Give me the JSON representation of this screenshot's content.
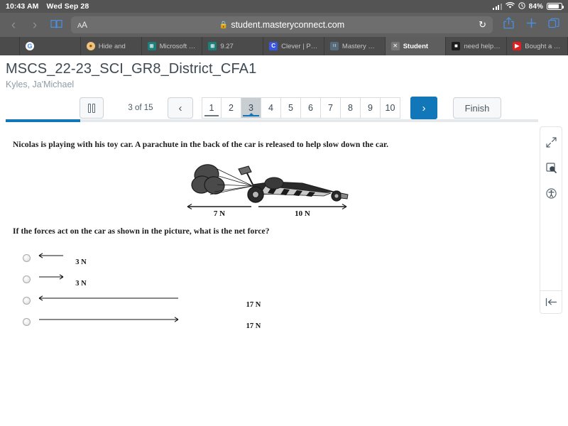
{
  "status_bar": {
    "time": "10:43 AM",
    "date": "Wed Sep 28",
    "battery_percent": "84%",
    "signal_icon": "cellular-signal-icon",
    "wifi_icon": "wifi-icon",
    "lock_rotation_icon": "rotation-lock-icon",
    "battery_icon": "battery-icon"
  },
  "browser": {
    "back_icon": "back-chevron-icon",
    "forward_icon": "forward-chevron-icon",
    "sidebar_icon": "book-sidebar-icon",
    "text_size_label_small": "A",
    "text_size_label_large": "A",
    "lock_icon": "padlock-icon",
    "url": "student.masteryconnect.com",
    "reload_icon": "reload-icon",
    "share_icon": "share-icon",
    "new_tab_icon": "plus-icon",
    "tabs_overview_icon": "tabs-icon"
  },
  "tabs": [
    {
      "label": "",
      "favicon": "generic-icon",
      "active": false,
      "spacer": true
    },
    {
      "label": "",
      "favicon": "google-icon",
      "active": false,
      "spacer": false
    },
    {
      "label": "Hide and",
      "favicon": "tan-site-icon",
      "active": false,
      "spacer": false
    },
    {
      "label": "Microsoft Fo...",
      "favicon": "microsoft-forms-icon",
      "active": false,
      "spacer": false
    },
    {
      "label": "9.27",
      "favicon": "microsoft-forms-icon",
      "active": false,
      "spacer": false
    },
    {
      "label": "Clever | Portal",
      "favicon": "clever-icon",
      "active": false,
      "spacer": false
    },
    {
      "label": "Mastery Con...",
      "favicon": "masteryconnect-icon",
      "active": false,
      "spacer": false
    },
    {
      "label": "Student",
      "favicon": "close-tab-icon",
      "active": true,
      "spacer": false
    },
    {
      "label": "need help hu...",
      "favicon": "dark-site-icon",
      "active": false,
      "spacer": false
    },
    {
      "label": "Bought a *F...",
      "favicon": "youtube-icon",
      "active": false,
      "spacer": false
    }
  ],
  "assessment": {
    "title": "MSCS_22-23_SCI_GR8_District_CFA1",
    "student": "Kyles, Ja'Michael"
  },
  "toolbar": {
    "pause_icon": "pause-icon",
    "counter": "3 of 15",
    "prev_icon": "‹",
    "next_icon": "›",
    "finish_label": "Finish",
    "pages": [
      "1",
      "2",
      "3",
      "4",
      "5",
      "6",
      "7",
      "8",
      "9",
      "10"
    ],
    "current_page": "3",
    "answered_pages": [
      "1"
    ]
  },
  "progress": {
    "percent": 14
  },
  "question": {
    "stem": "Nicolas is playing with his toy car. A parachute in the back of the car is released to help slow down the car.",
    "figure": {
      "alt": "dragster-with-parachute-figure",
      "left_force_label": "7 N",
      "right_force_label": "10 N"
    },
    "prompt": "If the forces act on the car as shown in the picture, what is the net force?",
    "choices": [
      {
        "id": "A",
        "label": "3 N",
        "direction": "left",
        "arrow_length": 34,
        "selected": false
      },
      {
        "id": "B",
        "label": "3 N",
        "direction": "right",
        "arrow_length": 34,
        "selected": false
      },
      {
        "id": "C",
        "label": "17 N",
        "direction": "left",
        "arrow_length": 196,
        "selected": false
      },
      {
        "id": "D",
        "label": "17 N",
        "direction": "right",
        "arrow_length": 196,
        "selected": false
      }
    ]
  },
  "tool_rail": {
    "buttons": [
      {
        "icon": "expand-fullscreen-icon"
      },
      {
        "icon": "magnifier-zoom-icon"
      },
      {
        "icon": "accessibility-icon"
      }
    ],
    "collapse_icon": "collapse-panel-icon"
  },
  "colors": {
    "accent": "#1277b8",
    "title_text": "#3c4953",
    "muted_text": "#8e9ba5",
    "chrome_dark": "#545454"
  }
}
